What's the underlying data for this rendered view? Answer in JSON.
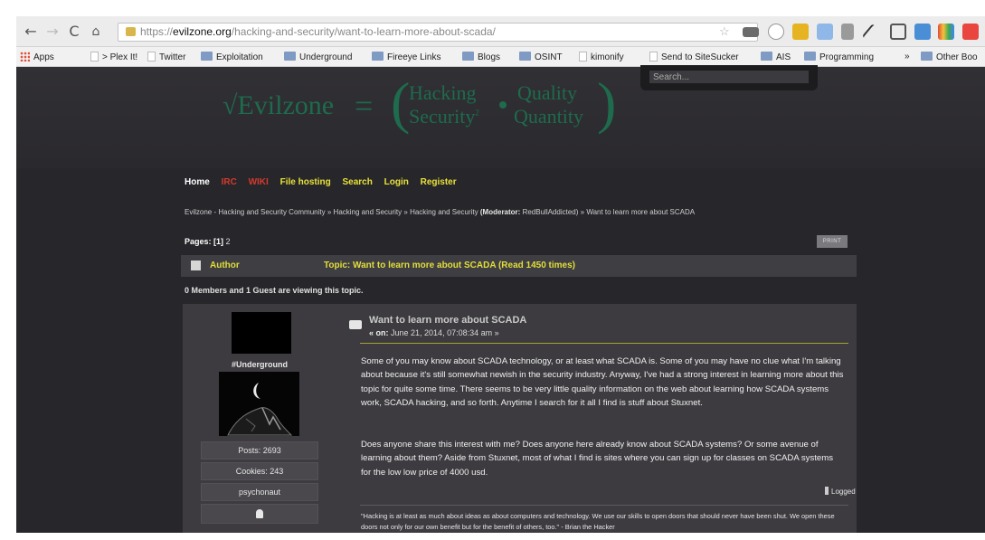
{
  "browser": {
    "url_protocol": "https://",
    "url_domain": "evilzone.org",
    "url_path": "/hacking-and-security/want-to-learn-more-about-scada/"
  },
  "bookmarks": [
    {
      "label": "Apps",
      "icon": "apps-grid-icon"
    },
    {
      "label": "> Plex It!",
      "icon": "page-icon"
    },
    {
      "label": "Twitter",
      "icon": "page-icon"
    },
    {
      "label": "Exploitation",
      "icon": "folder-icon"
    },
    {
      "label": "Underground",
      "icon": "folder-icon"
    },
    {
      "label": "Fireeye Links",
      "icon": "folder-icon"
    },
    {
      "label": "Blogs",
      "icon": "folder-icon"
    },
    {
      "label": "OSINT",
      "icon": "folder-icon"
    },
    {
      "label": "kimonify",
      "icon": "page-icon"
    },
    {
      "label": "Send to SiteSucker",
      "icon": "page-icon"
    },
    {
      "label": "AIS",
      "icon": "folder-icon"
    },
    {
      "label": "Programming",
      "icon": "folder-icon"
    },
    {
      "label": "»",
      "icon": ""
    },
    {
      "label": "Other Boo",
      "icon": "folder-icon"
    }
  ],
  "site": {
    "logo": {
      "root": "√Evilzone",
      "eq": "=",
      "word1": "Hacking",
      "word2": "Security",
      "word2_sup": "2",
      "word3": "Quality",
      "word4": "Quantity"
    },
    "search_placeholder": "Search..."
  },
  "nav": {
    "home": "Home",
    "irc": "IRC",
    "wiki": "WIKI",
    "file_hosting": "File hosting",
    "search": "Search",
    "login": "Login",
    "register": "Register"
  },
  "breadcrumb": {
    "community": "Evilzone - Hacking and Security Community",
    "board1": "Hacking and Security",
    "board2": "Hacking and Security",
    "moderator_label": "(Moderator:",
    "moderator_name": "RedBullAddicted)",
    "topic": "Want to learn more about SCADA",
    "separator": "»"
  },
  "pages": {
    "label": "Pages:",
    "current": "[1]",
    "other": "2",
    "print": "PRINT"
  },
  "topic_header": {
    "author": "Author",
    "topic": "Topic: Want to learn more about SCADA  (Read 1450 times)"
  },
  "viewing": "0 Members and 1 Guest are viewing this topic.",
  "post": {
    "author_group": "#Underground",
    "posts": "Posts: 2693",
    "cookies": "Cookies: 243",
    "username": "psychonaut",
    "title": "Want to learn more about SCADA",
    "date_prefix": "« on:",
    "date": "June 21, 2014, 07:08:34 am »",
    "paragraph1": "Some of you may know about SCADA technology, or at least what SCADA is. Some of you may have no clue what I'm talking about because it's still somewhat newish in the security industry. Anyway, I've had a strong interest in learning more about this topic for quite some time. There seems to be very little quality information on the web about learning how SCADA systems work, SCADA hacking, and so forth. Anytime I search for it all I find is stuff about Stuxnet.",
    "paragraph2": "Does anyone share this interest with me? Does anyone here already know about SCADA systems? Or some avenue of learning about them? Aside from Stuxnet, most of what I find is sites where you can sign up for classes on SCADA systems for the low low price of 4000 usd.",
    "logged": "Logged",
    "signature": "\"Hacking is at least as much about ideas as about computers and technology. We use our skills to open doors that should never have been shut. We open these doors not only for our own benefit but for the benefit of others, too.\" - Brian the Hacker"
  },
  "colors": {
    "page_bg": "#27262a",
    "header_bg": "#313034",
    "logo_green": "#1e6b4d",
    "accent_yellow": "#e2df3a",
    "nav_red": "#d43a2f"
  }
}
